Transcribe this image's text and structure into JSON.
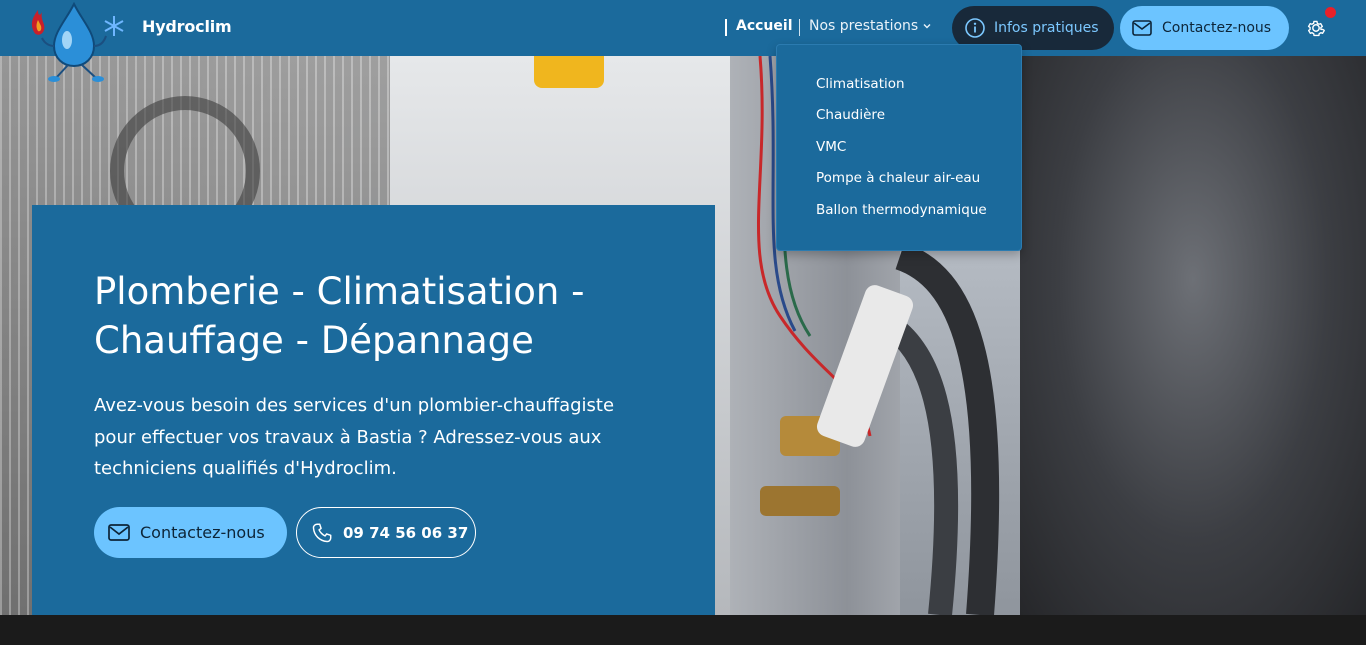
{
  "header": {
    "brand": "Hydroclim",
    "nav": {
      "accueil": "Accueil",
      "prestations": "Nos prestations"
    },
    "infos_button": "Infos pratiques",
    "contact_button": "Contactez-nous",
    "notification": true
  },
  "dropdown": {
    "items": [
      {
        "label": "Climatisation"
      },
      {
        "label": "Chaudière"
      },
      {
        "label": "VMC"
      },
      {
        "label": "Pompe à chaleur air-eau"
      },
      {
        "label": "Ballon thermodynamique"
      }
    ]
  },
  "hero": {
    "title": "Plomberie - Climatisation - Chauffage - Dépannage",
    "description": "Avez-vous besoin des services d'un plombier-chauffagiste pour effectuer vos travaux à Bastia ? Adressez-vous aux techniciens qualifiés d'Hydroclim.",
    "contact_button": "Contactez-nous",
    "phone_button": "09 74 56 06 37"
  },
  "colors": {
    "primary": "#1b6a9c",
    "accent": "#6cc4ff",
    "dark_button": "#18293a",
    "notification": "#e8202a"
  },
  "icons": {
    "logo": "water-drop-logo-icon",
    "chevron": "chevron-down-icon",
    "info": "info-icon",
    "mail": "mail-icon",
    "gear": "gear-icon",
    "phone": "phone-icon"
  }
}
